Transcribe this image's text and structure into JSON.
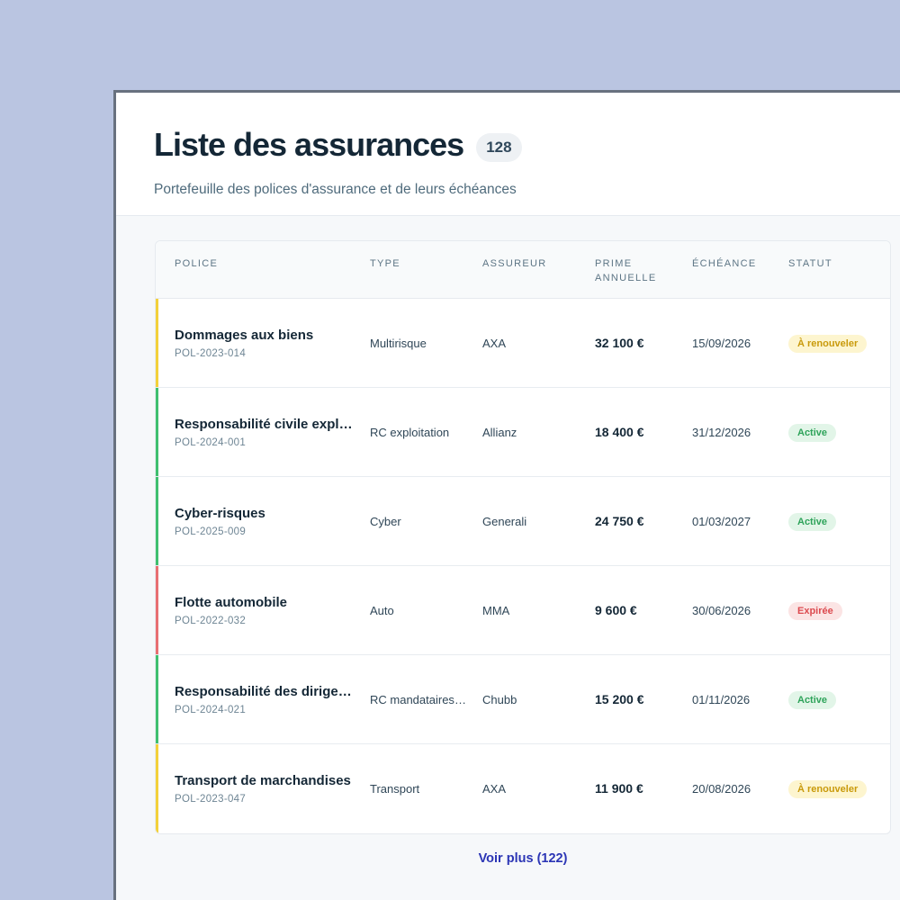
{
  "header": {
    "title": "Liste des assurances",
    "count": "128",
    "subtitle": "Portefeuille des polices d'assurance et de leurs échéances"
  },
  "table": {
    "columns": {
      "police": "POLICE",
      "type": "TYPE",
      "assureur": "ASSUREUR",
      "prime_line1": "PRIME",
      "prime_line2": "ANNUELLE",
      "echeance": "ÉCHÉANCE",
      "statut": "STATUT"
    },
    "rows": [
      {
        "name": "Dommages aux biens",
        "id": "POL-2023-014",
        "type": "Multirisque",
        "insurer": "AXA",
        "premium": "32 100 €",
        "due": "15/09/2026",
        "status": "À renouveler",
        "status_kind": "renew"
      },
      {
        "name": "Responsabilité civile exploitation",
        "id": "POL-2024-001",
        "type": "RC exploitation",
        "insurer": "Allianz",
        "premium": "18 400 €",
        "due": "31/12/2026",
        "status": "Active",
        "status_kind": "active"
      },
      {
        "name": "Cyber-risques",
        "id": "POL-2025-009",
        "type": "Cyber",
        "insurer": "Generali",
        "premium": "24 750 €",
        "due": "01/03/2027",
        "status": "Active",
        "status_kind": "active"
      },
      {
        "name": "Flotte automobile",
        "id": "POL-2022-032",
        "type": "Auto",
        "insurer": "MMA",
        "premium": "9 600 €",
        "due": "30/06/2026",
        "status": "Expirée",
        "status_kind": "expired"
      },
      {
        "name": "Responsabilité des dirigeants",
        "id": "POL-2024-021",
        "type": "RC mandataires sociaux",
        "insurer": "Chubb",
        "premium": "15 200 €",
        "due": "01/11/2026",
        "status": "Active",
        "status_kind": "active"
      },
      {
        "name": "Transport de marchandises",
        "id": "POL-2023-047",
        "type": "Transport",
        "insurer": "AXA",
        "premium": "11 900 €",
        "due": "20/08/2026",
        "status": "À renouveler",
        "status_kind": "renew"
      }
    ]
  },
  "footer": {
    "more_label": "Voir plus (122)"
  },
  "colors": {
    "renew_bar": "#f3d13a",
    "renew_bg": "#fdf5cf",
    "renew_text": "#c99a0b",
    "active_bar": "#3fbf6f",
    "active_bg": "#e2f5e8",
    "active_text": "#2ea35a",
    "expired_bar": "#e86f72",
    "expired_bg": "#fbe4e4",
    "expired_text": "#dc4a4f"
  }
}
